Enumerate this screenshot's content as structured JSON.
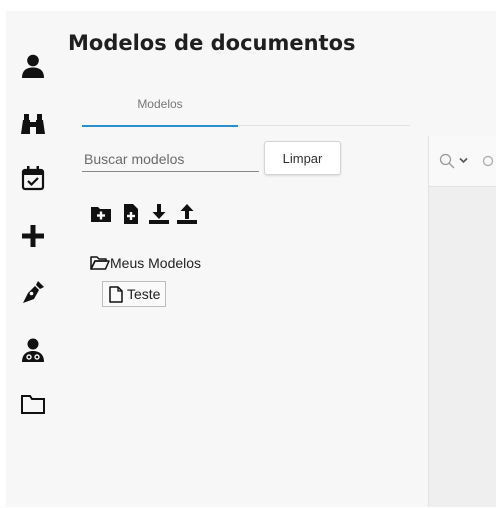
{
  "page": {
    "title": "Modelos de documentos"
  },
  "sidebar": {
    "icons": [
      "user-icon",
      "binoculars-icon",
      "calendar-check-icon",
      "plus-icon",
      "pen-nib-icon",
      "user-doctor-icon",
      "folder-icon"
    ]
  },
  "tabs": [
    {
      "label": "Modelos",
      "active": true
    }
  ],
  "search": {
    "placeholder": "Buscar modelos",
    "value": ""
  },
  "buttons": {
    "clear_label": "Limpar"
  },
  "toolbar": {
    "icons": [
      "folder-plus-icon",
      "file-plus-icon",
      "download-icon",
      "upload-icon"
    ]
  },
  "tree": {
    "folder_label": "Meus Modelos",
    "files": [
      {
        "label": "Teste"
      }
    ]
  },
  "right_panel": {
    "icons": [
      "search-icon",
      "chevron-down-icon"
    ]
  },
  "colors": {
    "accent": "#2a8fcf",
    "icon": "#111111",
    "panel": "#efefef"
  }
}
